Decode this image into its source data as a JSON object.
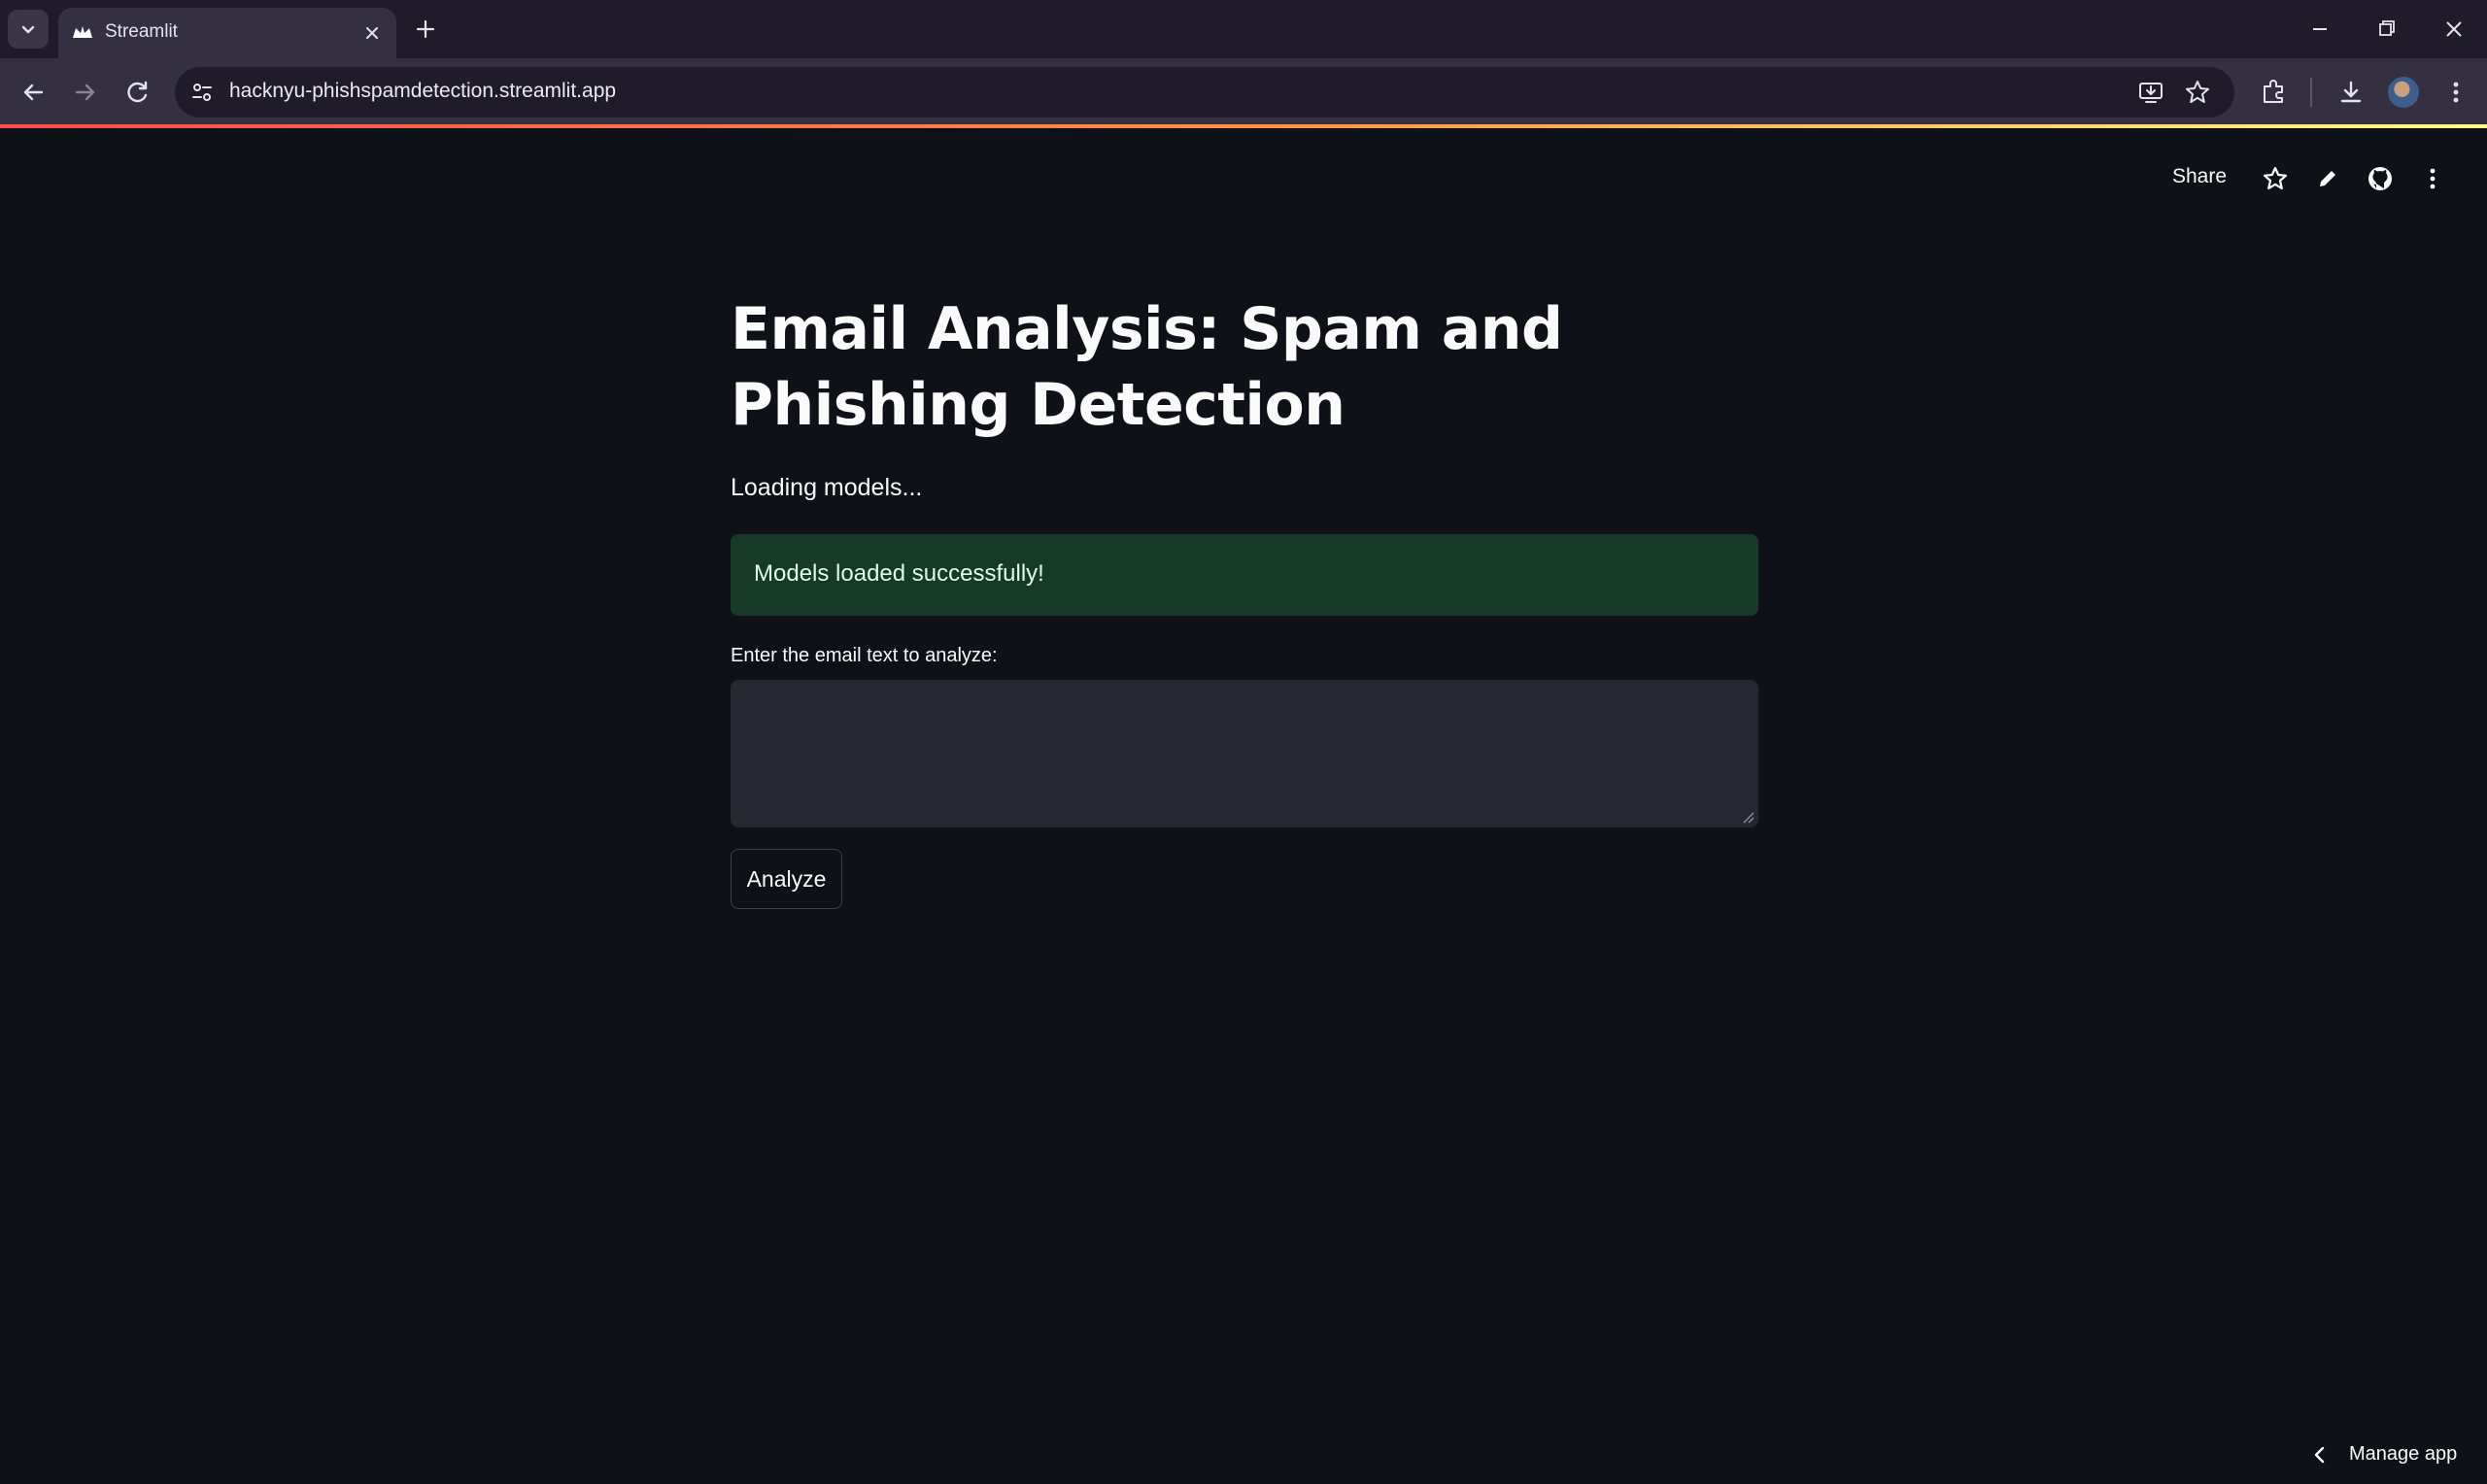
{
  "browser": {
    "tab_title": "Streamlit",
    "url": "hacknyu-phishspamdetection.streamlit.app"
  },
  "header": {
    "share_label": "Share"
  },
  "main": {
    "title": "Email Analysis: Spam and Phishing Detection",
    "loading_text": "Loading models...",
    "success_message": "Models loaded successfully!",
    "input_label": "Enter the email text to analyze:",
    "input_value": "",
    "analyze_label": "Analyze"
  },
  "footer": {
    "manage_label": "Manage app"
  },
  "icons": {
    "tab_search": "chevron-down-icon",
    "favicon": "streamlit-crown-icon",
    "github": "github-icon"
  },
  "colors": {
    "app_background": "#0e1117",
    "success_background": "#173928",
    "input_background": "#262730"
  }
}
